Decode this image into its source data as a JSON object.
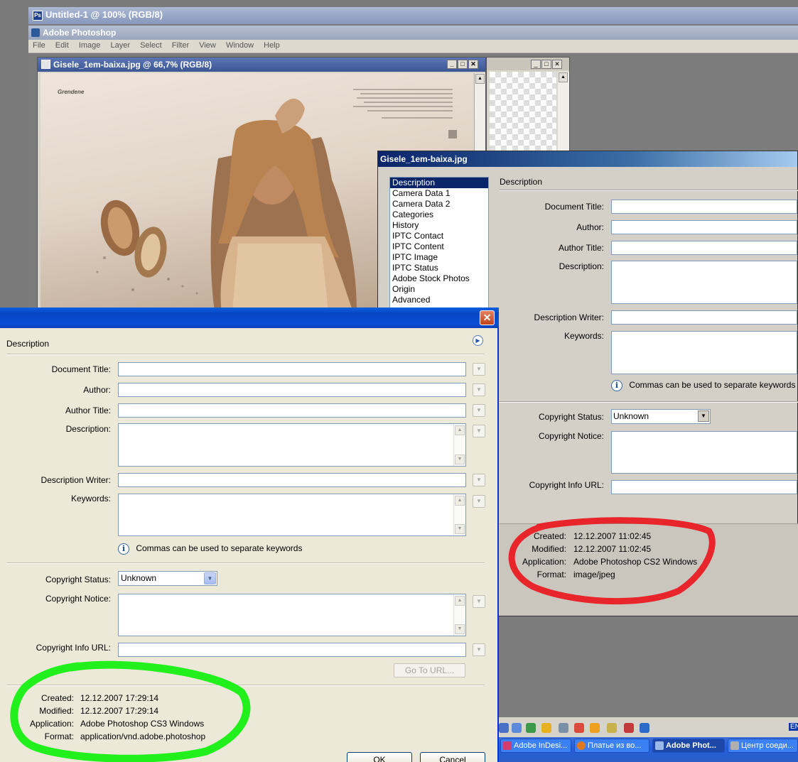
{
  "untitled_window": {
    "title": "Untitled-1 @ 100% (RGB/8)"
  },
  "app": {
    "title": "Adobe Photoshop"
  },
  "menu": [
    "File",
    "Edit",
    "Image",
    "Layer",
    "Select",
    "Filter",
    "View",
    "Window",
    "Help"
  ],
  "doc_window": {
    "title": "Gisele_1em-baixa.jpg @ 66,7% (RGB/8)",
    "brand_text": "Grendene"
  },
  "cs2_dialog": {
    "title": "Gisele_1em-baixa.jpg",
    "categories": [
      "Description",
      "Camera Data 1",
      "Camera Data 2",
      "Categories",
      "History",
      "IPTC Contact",
      "IPTC Content",
      "IPTC Image",
      "IPTC Status",
      "Adobe Stock Photos",
      "Origin",
      "Advanced"
    ],
    "selected_category": "Description",
    "section_label": "Description",
    "fields": {
      "document_title": "Document Title:",
      "author": "Author:",
      "author_title": "Author Title:",
      "description": "Description:",
      "description_writer": "Description Writer:",
      "keywords": "Keywords:",
      "keywords_hint": "Commas can be used to separate keywords",
      "copyright_status": "Copyright Status:",
      "copyright_status_value": "Unknown",
      "copyright_notice": "Copyright Notice:",
      "copyright_url": "Copyright Info URL:"
    },
    "metadata": {
      "created_label": "Created:",
      "created": "12.12.2007 11:02:45",
      "modified_label": "Modified:",
      "modified": "12.12.2007 11:02:45",
      "application_label": "Application:",
      "application": "Adobe Photoshop CS2 Windows",
      "format_label": "Format:",
      "format": "image/jpeg"
    }
  },
  "cs3_dialog": {
    "section_label": "Description",
    "fields": {
      "document_title": "Document Title:",
      "author": "Author:",
      "author_title": "Author Title:",
      "description": "Description:",
      "description_writer": "Description Writer:",
      "keywords": "Keywords:",
      "keywords_hint": "Commas can be used to separate keywords",
      "copyright_status": "Copyright Status:",
      "copyright_status_value": "Unknown",
      "copyright_notice": "Copyright Notice:",
      "copyright_url": "Copyright Info URL:",
      "goto_url": "Go To URL..."
    },
    "metadata": {
      "created_label": "Created:",
      "created": "12.12.2007 17:29:14",
      "modified_label": "Modified:",
      "modified": "12.12.2007 17:29:14",
      "application_label": "Application:",
      "application": "Adobe Photoshop CS3 Windows",
      "format_label": "Format:",
      "format": "application/vnd.adobe.photoshop"
    },
    "buttons": {
      "ok": "OK",
      "cancel": "Cancel"
    }
  },
  "taskbar": {
    "tasks": [
      "Adobe InDesi...",
      "Платье из во...",
      "Adobe Phot...",
      "Центр соеди..."
    ],
    "active_task": "Adobe Phot...",
    "language": "EN"
  },
  "colors": {
    "red_highlight": "#e8252b",
    "green_highlight": "#22f01c",
    "xp_title": "#0746c5"
  }
}
